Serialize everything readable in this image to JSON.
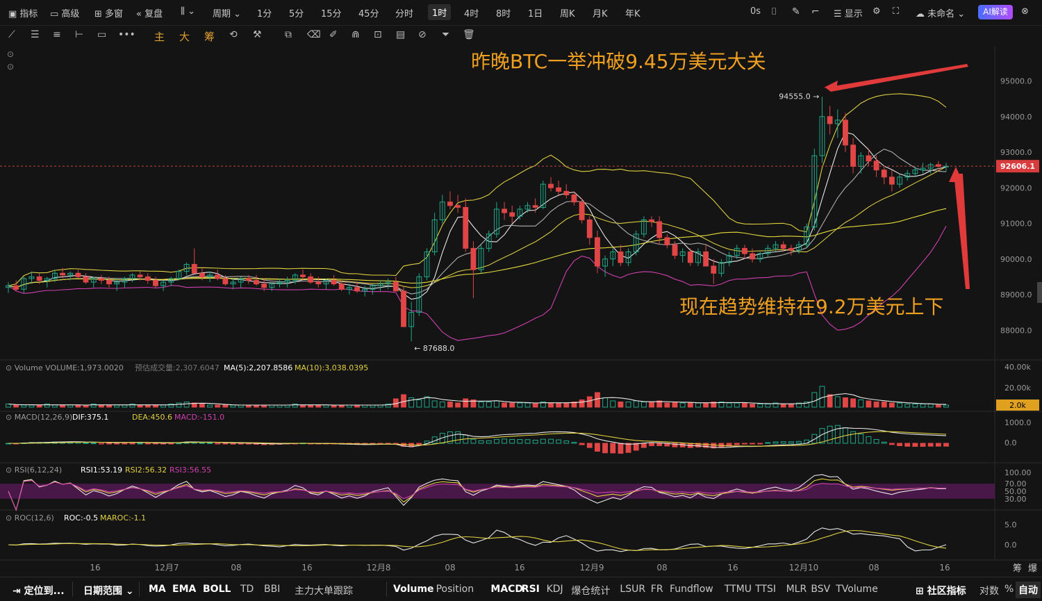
{
  "topbar": {
    "items": [
      {
        "label": "指标",
        "icon": "chart-icon"
      },
      {
        "label": "高级",
        "icon": "calendar-icon"
      },
      {
        "label": "多窗",
        "icon": "grid-icon"
      },
      {
        "label": "复盘",
        "icon": "rewind-icon"
      },
      {
        "label": "",
        "icon": "candle-type-icon"
      },
      {
        "label": "周期"
      },
      {
        "label": "1分"
      },
      {
        "label": "5分"
      },
      {
        "label": "15分"
      },
      {
        "label": "45分"
      },
      {
        "label": "分时"
      },
      {
        "label": "1时",
        "active": true
      },
      {
        "label": "4时"
      },
      {
        "label": "8时"
      },
      {
        "label": "1日"
      },
      {
        "label": "周K"
      },
      {
        "label": "月K"
      },
      {
        "label": "年K"
      }
    ],
    "right": {
      "timer": "0s",
      "display": "显示",
      "name": "未命名",
      "ai": "AI解读"
    }
  },
  "drawing_tools": {
    "zh_tools": [
      "主",
      "大",
      "筹"
    ]
  },
  "annotations": {
    "headline": "昨晚BTC一举冲破9.45万美元大关",
    "note": "现在趋势维持在9.2万美元上下",
    "high_label": "94555.0",
    "low_label": "87688.0",
    "current_price": "92606.1"
  },
  "panels": {
    "volume": {
      "title": "Volume",
      "value": "VOLUME:1,973.0020",
      "est": "预估成交量:2,307.6047",
      "ma5": "MA(5):2,207.8586",
      "ma10": "MA(10):3,038.0395",
      "axis": [
        "40.00k",
        "20.00k"
      ],
      "badge": "2.0k"
    },
    "macd": {
      "title": "MACD(12,26,9)",
      "dif": "DIF:375.1",
      "dea": "DEA:450.6",
      "macd": "MACD:-151.0",
      "axis": [
        "1000.0",
        "0.0"
      ]
    },
    "rsi": {
      "title": "RSI(6,12,24)",
      "rsi1": "RSI1:53.19",
      "rsi2": "RSI2:56.32",
      "rsi3": "RSI3:56.55",
      "axis": [
        "100.00",
        "70.00",
        "50.00",
        "30.00"
      ]
    },
    "roc": {
      "title": "ROC(12,6)",
      "roc": "ROC:-0.5",
      "maroc": "MAROC:-1.1",
      "axis": [
        "5.0",
        "0.0"
      ]
    }
  },
  "price_axis": [
    "95000.0",
    "94000.0",
    "93000.0",
    "92000.0",
    "91000.0",
    "90000.0",
    "89000.0",
    "88000.0"
  ],
  "time_axis": [
    "16",
    "12月7",
    "08",
    "16",
    "12月8",
    "08",
    "16",
    "12月9",
    "08",
    "16",
    "12月10",
    "08",
    "16"
  ],
  "corner": {
    "a": "筹",
    "b": "爆"
  },
  "bottombar": {
    "locate": "定位到...",
    "range": "日期范围",
    "indicators_main": [
      "MA",
      "EMA",
      "BOLL",
      "TD",
      "BBI",
      "主力大单跟踪"
    ],
    "indicators_sub": [
      "Volume",
      "Position",
      "MACD",
      "RSI",
      "KDJ",
      "爆仓统计",
      "LSUR",
      "FR",
      "Fundflow",
      "TTMU",
      "TTSI",
      "MLR",
      "BSV",
      "TVolume"
    ],
    "community": "社区指标",
    "log": "对数",
    "pct": "%",
    "auto": "自动"
  },
  "colors": {
    "up": "#1fa98a",
    "down": "#e04646",
    "yellow": "#e0d040",
    "magenta": "#d040b0",
    "annotation": "#f0a020",
    "arrow": "#e03a3a"
  },
  "chart_data": {
    "type": "candlestick",
    "interval": "1h",
    "ylim": [
      87400,
      95400
    ],
    "high": 94555.0,
    "low": 87688.0,
    "last": 92606.1,
    "candles": [
      [
        89200,
        89350,
        89050,
        89250
      ],
      [
        89250,
        89400,
        89100,
        89150
      ],
      [
        89150,
        89500,
        89050,
        89450
      ],
      [
        89450,
        89650,
        89300,
        89500
      ],
      [
        89500,
        89600,
        89300,
        89400
      ],
      [
        89400,
        89500,
        89200,
        89450
      ],
      [
        89450,
        89700,
        89350,
        89600
      ],
      [
        89600,
        89750,
        89450,
        89550
      ],
      [
        89550,
        89650,
        89400,
        89600
      ],
      [
        89600,
        89700,
        89450,
        89500
      ],
      [
        89500,
        89600,
        89300,
        89350
      ],
      [
        89350,
        89500,
        89200,
        89450
      ],
      [
        89450,
        89550,
        89300,
        89400
      ],
      [
        89400,
        89500,
        89200,
        89300
      ],
      [
        89300,
        89450,
        89100,
        89350
      ],
      [
        89350,
        89500,
        89200,
        89450
      ],
      [
        89450,
        89600,
        89350,
        89550
      ],
      [
        89550,
        89650,
        89400,
        89500
      ],
      [
        89500,
        89600,
        89300,
        89400
      ],
      [
        89400,
        89500,
        89200,
        89250
      ],
      [
        89250,
        89400,
        89100,
        89350
      ],
      [
        89350,
        89500,
        89250,
        89450
      ],
      [
        89450,
        89700,
        89400,
        89650
      ],
      [
        89650,
        89900,
        89550,
        89850
      ],
      [
        89850,
        90300,
        89700,
        89600
      ],
      [
        89600,
        89750,
        89400,
        89500
      ],
      [
        89500,
        89650,
        89350,
        89550
      ],
      [
        89550,
        89700,
        89400,
        89450
      ],
      [
        89450,
        89550,
        89250,
        89300
      ],
      [
        89300,
        89450,
        89150,
        89350
      ],
      [
        89350,
        89500,
        89200,
        89450
      ],
      [
        89450,
        89550,
        89300,
        89400
      ],
      [
        89400,
        89550,
        89250,
        89300
      ],
      [
        89300,
        89450,
        89100,
        89200
      ],
      [
        89200,
        89350,
        89100,
        89300
      ],
      [
        89300,
        89450,
        89200,
        89350
      ],
      [
        89350,
        89500,
        89200,
        89400
      ],
      [
        89400,
        89600,
        89300,
        89550
      ],
      [
        89550,
        89700,
        89400,
        89500
      ],
      [
        89500,
        89600,
        89300,
        89350
      ],
      [
        89350,
        89500,
        89200,
        89300
      ],
      [
        89300,
        89450,
        89150,
        89400
      ],
      [
        89400,
        89550,
        89250,
        89300
      ],
      [
        89300,
        89400,
        89100,
        89150
      ],
      [
        89150,
        89300,
        89000,
        89200
      ],
      [
        89200,
        89350,
        89050,
        89100
      ],
      [
        89100,
        89250,
        88950,
        89150
      ],
      [
        89150,
        89300,
        89000,
        89250
      ],
      [
        89250,
        89400,
        89100,
        89300
      ],
      [
        89300,
        89450,
        89150,
        89350
      ],
      [
        89350,
        89500,
        89200,
        89100
      ],
      [
        89100,
        89250,
        88200,
        88100
      ],
      [
        88100,
        88800,
        87688,
        88500
      ],
      [
        88500,
        89600,
        88400,
        89500
      ],
      [
        89500,
        90300,
        89400,
        90200
      ],
      [
        90200,
        91300,
        90100,
        91100
      ],
      [
        91100,
        91800,
        91000,
        91600
      ],
      [
        91600,
        91900,
        91400,
        91500
      ],
      [
        91500,
        91800,
        91300,
        91450
      ],
      [
        91450,
        91700,
        90200,
        90300
      ],
      [
        90300,
        90500,
        88900,
        89700
      ],
      [
        89700,
        90400,
        89600,
        90300
      ],
      [
        90300,
        90800,
        90200,
        90700
      ],
      [
        90700,
        91600,
        90600,
        91400
      ],
      [
        91400,
        91600,
        91100,
        91300
      ],
      [
        91300,
        91500,
        91000,
        91200
      ],
      [
        91200,
        91500,
        91100,
        91400
      ],
      [
        91400,
        91600,
        91300,
        91500
      ],
      [
        91500,
        91700,
        91300,
        91450
      ],
      [
        91450,
        92200,
        91400,
        92100
      ],
      [
        92100,
        92300,
        91900,
        92000
      ],
      [
        92000,
        92200,
        91800,
        91900
      ],
      [
        91900,
        92100,
        91700,
        91800
      ],
      [
        91800,
        91900,
        91500,
        91600
      ],
      [
        91600,
        91700,
        91000,
        91100
      ],
      [
        91100,
        91200,
        90400,
        90600
      ],
      [
        90600,
        90800,
        89600,
        89800
      ],
      [
        89800,
        90100,
        89500,
        90000
      ],
      [
        90000,
        90300,
        89800,
        90200
      ],
      [
        90200,
        90400,
        89800,
        89900
      ],
      [
        89900,
        90300,
        89800,
        90200
      ],
      [
        90200,
        90800,
        90100,
        90700
      ],
      [
        90700,
        91200,
        90600,
        91100
      ],
      [
        91100,
        91200,
        90900,
        91050
      ],
      [
        91050,
        91200,
        90400,
        90600
      ],
      [
        90600,
        90700,
        90300,
        90400
      ],
      [
        90400,
        90500,
        90000,
        90100
      ],
      [
        90100,
        90300,
        89900,
        90200
      ],
      [
        90200,
        90300,
        89800,
        89900
      ],
      [
        89900,
        90300,
        89800,
        90200
      ],
      [
        90200,
        90400,
        90000,
        89800
      ],
      [
        89800,
        90000,
        89300,
        89600
      ],
      [
        89600,
        90000,
        89500,
        89900
      ],
      [
        89900,
        90200,
        89800,
        90100
      ],
      [
        90100,
        90400,
        90000,
        90300
      ],
      [
        90300,
        90400,
        90000,
        90150
      ],
      [
        90150,
        90300,
        89900,
        90000
      ],
      [
        90000,
        90200,
        89900,
        90150
      ],
      [
        90150,
        90400,
        90050,
        90300
      ],
      [
        90300,
        90500,
        90200,
        90400
      ],
      [
        90400,
        90500,
        90200,
        90300
      ],
      [
        90300,
        90400,
        90100,
        90250
      ],
      [
        90250,
        90500,
        90150,
        90400
      ],
      [
        90400,
        91000,
        90300,
        90900
      ],
      [
        90900,
        93100,
        90800,
        92900
      ],
      [
        92900,
        94555,
        92700,
        94000
      ],
      [
        94000,
        94300,
        93500,
        93800
      ],
      [
        93800,
        94200,
        93400,
        93900
      ],
      [
        93900,
        94100,
        93000,
        93200
      ],
      [
        93200,
        93400,
        92400,
        92600
      ],
      [
        92600,
        93000,
        92400,
        92900
      ],
      [
        92900,
        93100,
        92600,
        92750
      ],
      [
        92750,
        92900,
        92300,
        92500
      ],
      [
        92500,
        92600,
        92100,
        92300
      ],
      [
        92300,
        92500,
        91900,
        92100
      ],
      [
        92100,
        92400,
        92000,
        92300
      ],
      [
        92300,
        92500,
        92200,
        92400
      ],
      [
        92400,
        92600,
        92300,
        92500
      ],
      [
        92500,
        92700,
        92400,
        92550
      ],
      [
        92550,
        92700,
        92400,
        92650
      ],
      [
        92650,
        92750,
        92500,
        92600
      ],
      [
        92600,
        92700,
        92450,
        92606.1
      ]
    ],
    "volume_k": [
      3,
      2,
      2,
      2,
      2,
      3,
      2,
      2,
      2,
      2,
      2,
      3,
      2,
      2,
      2,
      2,
      3,
      2,
      2,
      2,
      2,
      3,
      4,
      5,
      4,
      3,
      2,
      2,
      2,
      2,
      2,
      2,
      2,
      2,
      2,
      2,
      2,
      3,
      2,
      2,
      2,
      2,
      2,
      2,
      2,
      2,
      2,
      2,
      2,
      3,
      8,
      12,
      9,
      7,
      10,
      6,
      5,
      5,
      4,
      8,
      7,
      5,
      5,
      6,
      4,
      4,
      4,
      4,
      4,
      5,
      4,
      4,
      4,
      5,
      7,
      10,
      14,
      9,
      6,
      5,
      5,
      6,
      5,
      5,
      6,
      4,
      5,
      4,
      4,
      4,
      4,
      5,
      5,
      4,
      4,
      4,
      3,
      3,
      3,
      4,
      3,
      3,
      4,
      5,
      14,
      20,
      12,
      10,
      9,
      8,
      7,
      6,
      5,
      5,
      4,
      4,
      3,
      3,
      3,
      3,
      2,
      2
    ],
    "bollinger": {
      "upper_start": 93100,
      "mid": "MA20",
      "lower_start": 88300
    },
    "rsi_levels": [
      70,
      50,
      30
    ]
  }
}
